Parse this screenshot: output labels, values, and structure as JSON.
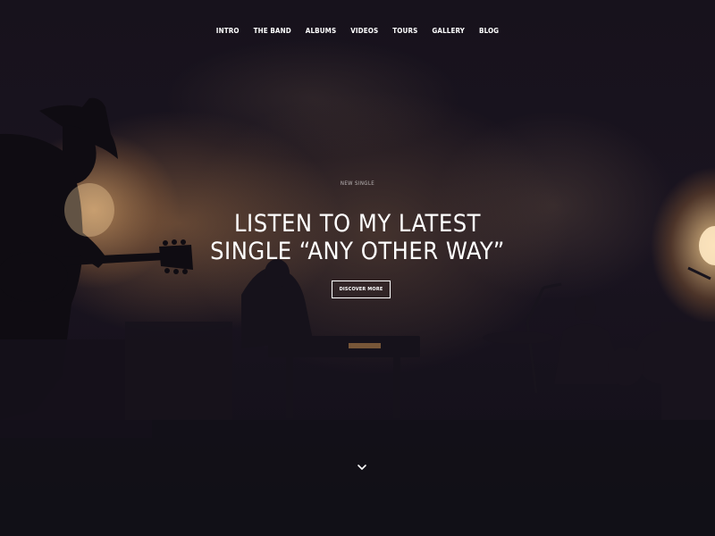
{
  "nav": {
    "items": [
      {
        "label": "INTRO"
      },
      {
        "label": "THE BAND"
      },
      {
        "label": "ALBUMS"
      },
      {
        "label": "VIDEOS"
      },
      {
        "label": "TOURS"
      },
      {
        "label": "GALLERY"
      },
      {
        "label": "BLOG"
      }
    ]
  },
  "hero": {
    "eyebrow": "NEW SINGLE",
    "headline_line1": "LISTEN TO MY LATEST",
    "headline_line2": "SINGLE “ANY OTHER WAY”",
    "cta_label": "DISCOVER MORE",
    "scroll_icon": "chevron-down-icon"
  },
  "colors": {
    "background": "#15111c",
    "text": "#ffffff",
    "stage_light": "#f5c98a"
  }
}
